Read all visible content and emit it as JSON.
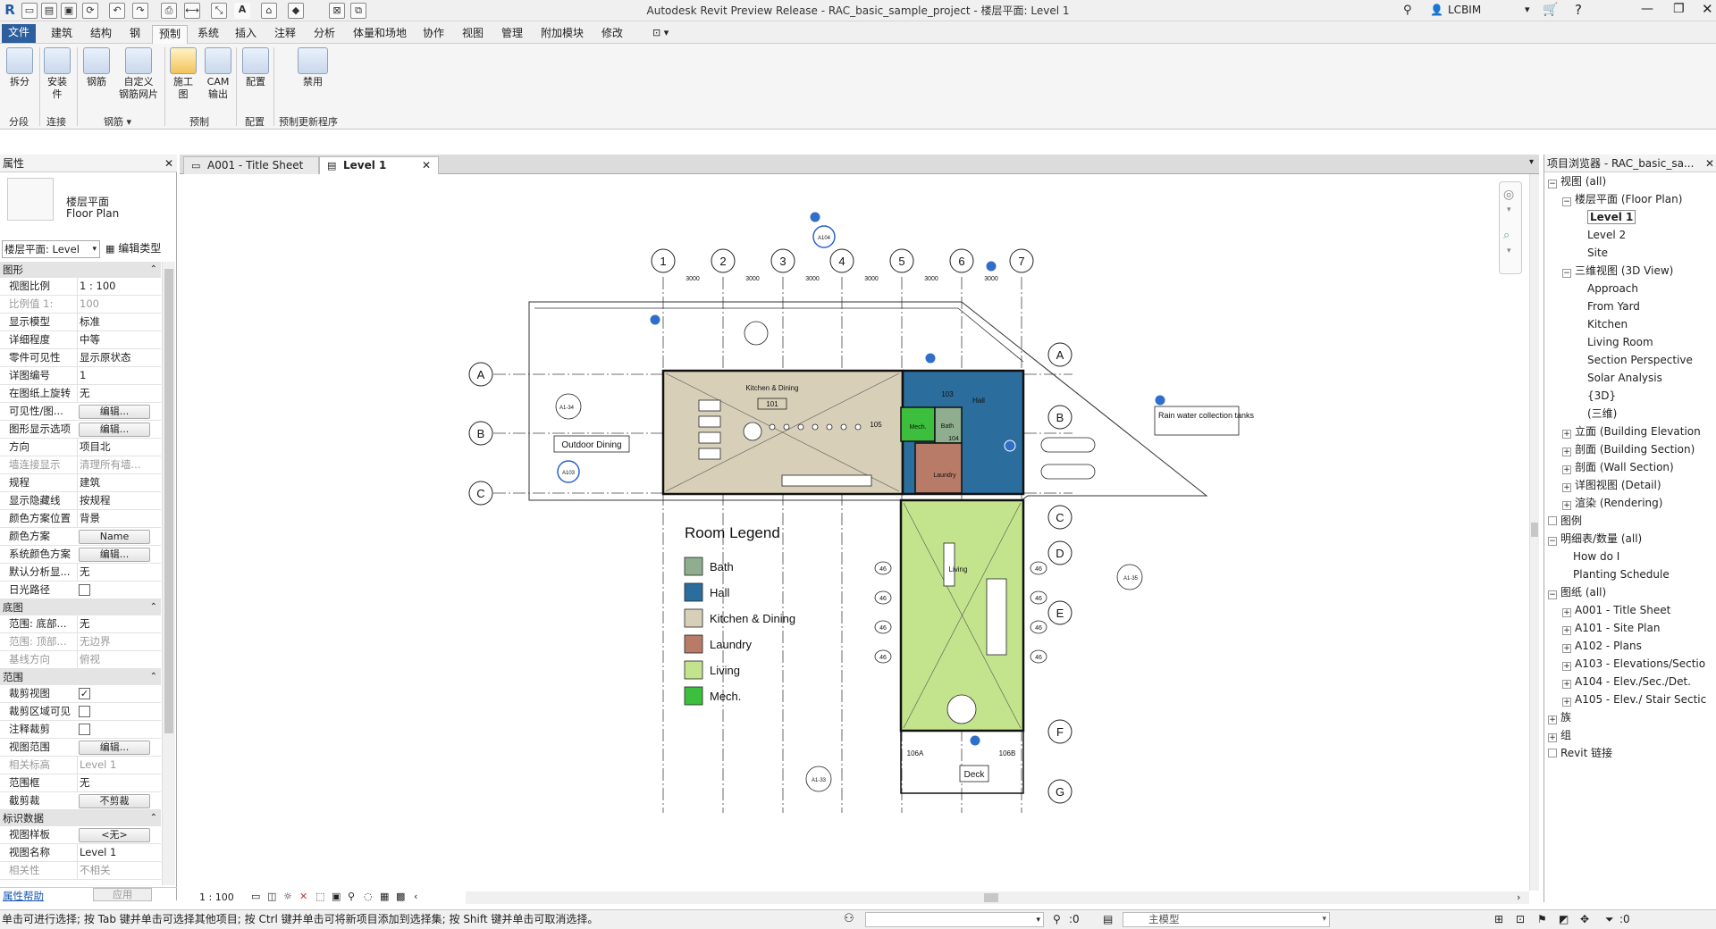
{
  "app": {
    "title": "Autodesk Revit Preview Release - RAC_basic_sample_project - 楼层平面: Level 1",
    "user": "LCBIM"
  },
  "menu": [
    "文件",
    "建筑",
    "结构",
    "钢",
    "预制",
    "系统",
    "插入",
    "注释",
    "分析",
    "体量和场地",
    "协作",
    "视图",
    "管理",
    "附加模块",
    "修改"
  ],
  "ribbon": {
    "buttons": [
      {
        "label": "拆分"
      },
      {
        "label": "安装\n件"
      },
      {
        "label": "钢筋"
      },
      {
        "label": "自定义\n钢筋网片"
      },
      {
        "label": "施工\n图"
      },
      {
        "label": "CAM\n输出"
      },
      {
        "label": "配置"
      },
      {
        "label": "禁用"
      }
    ],
    "groups": [
      "分段",
      "连接",
      "钢筋 ▾",
      "预制",
      "配置",
      "预制更新程序"
    ]
  },
  "properties": {
    "title": "属性",
    "type_name": "楼层平面",
    "type_name_en": "Floor Plan",
    "selector": "楼层平面: Level",
    "edit_type": "编辑类型",
    "sections": {
      "graphics": "图形",
      "underlay": "底图",
      "extents": "范围",
      "identity": "标识数据"
    },
    "rows_graphics": [
      {
        "k": "视图比例",
        "v": "1 : 100"
      },
      {
        "k": "比例值 1:",
        "v": "100",
        "dim": true
      },
      {
        "k": "显示模型",
        "v": "标准"
      },
      {
        "k": "详细程度",
        "v": "中等"
      },
      {
        "k": "零件可见性",
        "v": "显示原状态"
      },
      {
        "k": "详图编号",
        "v": "1"
      },
      {
        "k": "在图纸上旋转",
        "v": "无"
      },
      {
        "k": "可见性/图...",
        "btn": "编辑..."
      },
      {
        "k": "图形显示选项",
        "btn": "编辑..."
      },
      {
        "k": "方向",
        "v": "项目北"
      },
      {
        "k": "墙连接显示",
        "v": "清理所有墙...",
        "dim": true
      },
      {
        "k": "规程",
        "v": "建筑"
      },
      {
        "k": "显示隐藏线",
        "v": "按规程"
      },
      {
        "k": "颜色方案位置",
        "v": "背景"
      },
      {
        "k": "颜色方案",
        "btn": "Name"
      },
      {
        "k": "系统颜色方案",
        "btn": "编辑..."
      },
      {
        "k": "默认分析显...",
        "v": "无"
      },
      {
        "k": "日光路径",
        "cb": ""
      }
    ],
    "rows_underlay": [
      {
        "k": "范围: 底部...",
        "v": "无"
      },
      {
        "k": "范围: 顶部...",
        "v": "无边界",
        "dim": true
      },
      {
        "k": "基线方向",
        "v": "俯视",
        "dim": true
      }
    ],
    "rows_extents": [
      {
        "k": "裁剪视图",
        "cb": "✓"
      },
      {
        "k": "裁剪区域可见",
        "cb": ""
      },
      {
        "k": "注释裁剪",
        "cb": ""
      },
      {
        "k": "视图范围",
        "btn": "编辑..."
      },
      {
        "k": "相关标高",
        "v": "Level 1",
        "dim": true
      },
      {
        "k": "范围框",
        "v": "无"
      },
      {
        "k": "截剪裁",
        "btn": "不剪裁"
      }
    ],
    "rows_identity": [
      {
        "k": "视图样板",
        "btn": "<无>"
      },
      {
        "k": "视图名称",
        "v": "Level 1"
      },
      {
        "k": "相关性",
        "v": "不相关",
        "dim": true
      }
    ],
    "help": "属性帮助",
    "apply": "应用"
  },
  "view_tabs": [
    {
      "label": "A001 - Title Sheet"
    },
    {
      "label": "Level 1"
    }
  ],
  "plan": {
    "grid_cols": [
      "1",
      "2",
      "3",
      "4",
      "5",
      "6",
      "7"
    ],
    "grid_rows_left": [
      "A",
      "B",
      "C"
    ],
    "grid_rows_right": [
      "A",
      "B",
      "C",
      "D",
      "E",
      "F",
      "G"
    ],
    "dim": "3000",
    "legend_title": "Room Legend",
    "legend": [
      {
        "label": "Bath",
        "color": "#8fae8f"
      },
      {
        "label": "Hall",
        "color": "#2b6e9e"
      },
      {
        "label": "Kitchen & Dining",
        "color": "#d8cfb8"
      },
      {
        "label": "Laundry",
        "color": "#b77b68"
      },
      {
        "label": "Living",
        "color": "#c3e48c"
      },
      {
        "label": "Mech.",
        "color": "#3cbf3c"
      }
    ],
    "labels": {
      "outdoor": "Outdoor Dining",
      "rain": "Rain water collection tanks",
      "deck": "Deck",
      "kitchen": "Kitchen & Dining",
      "hall": "Hall",
      "living": "Living",
      "laundry": "Laundry",
      "bath": "Bath",
      "mech": "Mech.",
      "r101": "101",
      "r105": "105",
      "r103": "103",
      "r104": "104",
      "r106a": "106A",
      "r106b": "106B",
      "callout_a134": "A1-34",
      "callout_a103": "A103",
      "callout_a133": "A1-33",
      "callout_a135": "A1-35",
      "callout_a104": "A104",
      "tag46": "46"
    }
  },
  "browser": {
    "title": "项目浏览器 - RAC_basic_sa...",
    "nodes": [
      {
        "t": "视图 (all)",
        "lvl": 0,
        "tg": "−"
      },
      {
        "t": "楼层平面 (Floor Plan)",
        "lvl": 1,
        "tg": "−"
      },
      {
        "t": "Level 1",
        "lvl": 2,
        "bold": true
      },
      {
        "t": "Level 2",
        "lvl": 2
      },
      {
        "t": "Site",
        "lvl": 2
      },
      {
        "t": "三维视图 (3D View)",
        "lvl": 1,
        "tg": "−"
      },
      {
        "t": "Approach",
        "lvl": 2
      },
      {
        "t": "From Yard",
        "lvl": 2
      },
      {
        "t": "Kitchen",
        "lvl": 2
      },
      {
        "t": "Living Room",
        "lvl": 2
      },
      {
        "t": "Section Perspective",
        "lvl": 2
      },
      {
        "t": "Solar Analysis",
        "lvl": 2
      },
      {
        "t": "{3D}",
        "lvl": 2
      },
      {
        "t": "(三维)",
        "lvl": 2
      },
      {
        "t": "立面 (Building Elevation",
        "lvl": 1,
        "tg": "+"
      },
      {
        "t": "剖面 (Building Section)",
        "lvl": 1,
        "tg": "+"
      },
      {
        "t": "剖面 (Wall Section)",
        "lvl": 1,
        "tg": "+"
      },
      {
        "t": "详图视图 (Detail)",
        "lvl": 1,
        "tg": "+"
      },
      {
        "t": "渲染 (Rendering)",
        "lvl": 1,
        "tg": "+"
      },
      {
        "t": "图例",
        "lvl": 0,
        "tg": ""
      },
      {
        "t": "明细表/数量 (all)",
        "lvl": 0,
        "tg": "−"
      },
      {
        "t": "How do I",
        "lvl": 1
      },
      {
        "t": "Planting Schedule",
        "lvl": 1
      },
      {
        "t": "图纸 (all)",
        "lvl": 0,
        "tg": "−"
      },
      {
        "t": "A001 - Title Sheet",
        "lvl": 1,
        "tg": "+"
      },
      {
        "t": "A101 - Site Plan",
        "lvl": 1,
        "tg": "+"
      },
      {
        "t": "A102 - Plans",
        "lvl": 1,
        "tg": "+"
      },
      {
        "t": "A103 - Elevations/Sectio",
        "lvl": 1,
        "tg": "+"
      },
      {
        "t": "A104 - Elev./Sec./Det.",
        "lvl": 1,
        "tg": "+"
      },
      {
        "t": "A105 - Elev./ Stair Sectic",
        "lvl": 1,
        "tg": "+"
      },
      {
        "t": "族",
        "lvl": 0,
        "tg": "+"
      },
      {
        "t": "组",
        "lvl": 0,
        "tg": "+"
      },
      {
        "t": "Revit 链接",
        "lvl": 0,
        "tg": ""
      }
    ]
  },
  "viewbar": {
    "scale": "1 : 100"
  },
  "status": {
    "message": "单击可进行选择; 按 Tab 键并单击可选择其他项目; 按 Ctrl 键并单击可将新项目添加到选择集; 按 Shift 键并单击可取消选择。",
    "count": ":0",
    "model": "主模型"
  }
}
